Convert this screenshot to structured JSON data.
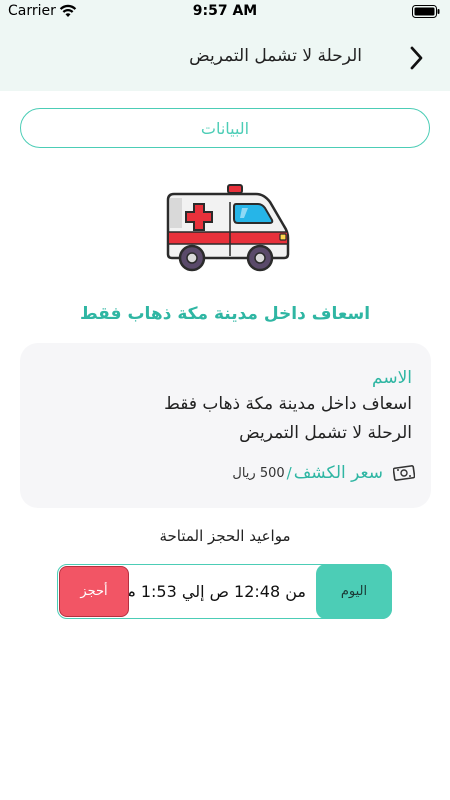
{
  "status_bar": {
    "carrier": "Carrier",
    "time": "9:57 AM"
  },
  "header": {
    "title": "الرحلة لا تشمل التمريض",
    "back_icon": "chevron-right-icon"
  },
  "tabs": {
    "data_label": "البيانات"
  },
  "service": {
    "icon": "ambulance-icon",
    "title": "اسعاف داخل مدينة مكة ذهاب فقط"
  },
  "card": {
    "name_label": "الاسم",
    "line1": "اسعاف داخل مدينة مكة ذهاب فقط",
    "line2": "الرحلة لا تشمل التمريض",
    "price_label": "سعر الكشف",
    "price_separator": "/",
    "price_value": "500 ريال",
    "price_icon": "money-icon"
  },
  "slots": {
    "heading": "مواعيد الحجز المتاحة",
    "items": [
      {
        "day": "اليوم",
        "time_text": "من 12:48 ص  إلي 1:53 م",
        "book_label": "أحجز"
      }
    ]
  },
  "colors": {
    "accent": "#4ccdb6",
    "accent_text": "#2fb6a3",
    "book_button": "#f25565",
    "header_bg": "#eef7f4",
    "card_bg": "#f6f6f8"
  }
}
